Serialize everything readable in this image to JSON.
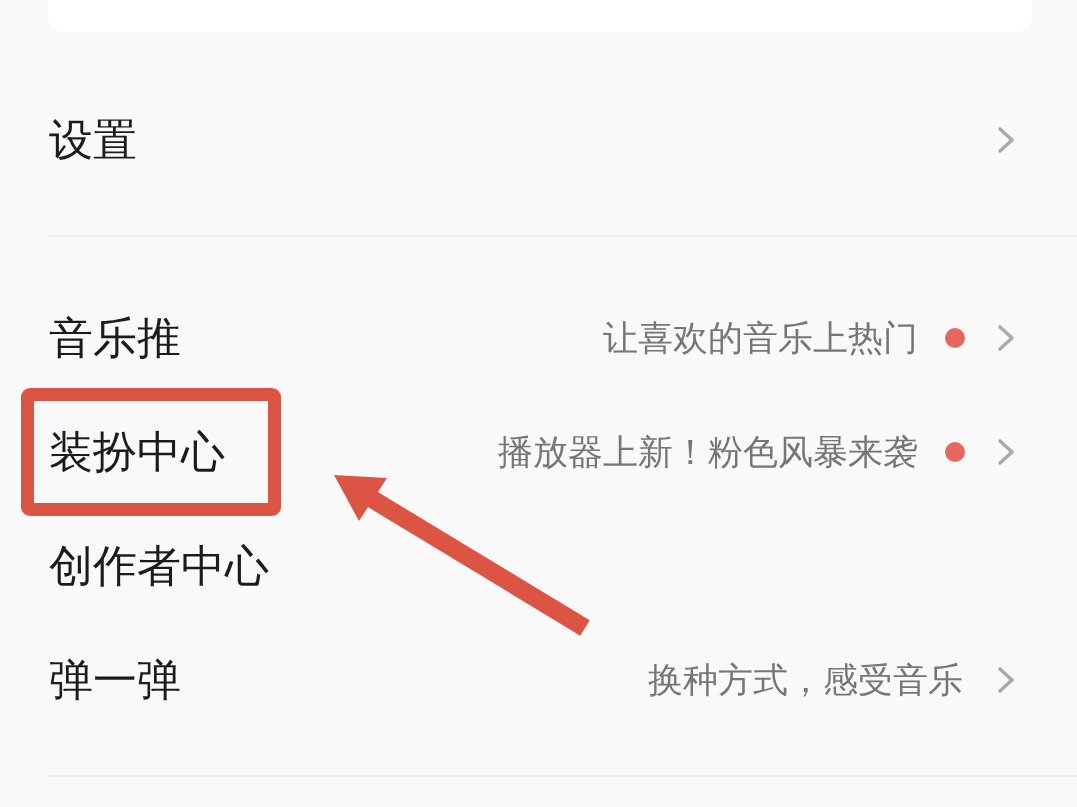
{
  "menu_groups": [
    {
      "items": [
        {
          "label": "设置",
          "dot": false,
          "chevron": true,
          "highlighted": false
        }
      ]
    },
    {
      "items": [
        {
          "label": "音乐推",
          "subtitle": "让喜欢的音乐上热门",
          "dot": true,
          "chevron": true,
          "highlighted": false
        },
        {
          "label": "装扮中心",
          "subtitle": "播放器上新！粉色风暴来袭",
          "dot": true,
          "chevron": true,
          "highlighted": true
        },
        {
          "label": "创作者中心",
          "dot": false,
          "chevron": false,
          "highlighted": false
        },
        {
          "label": "弹一弹",
          "subtitle": "换种方式，感受音乐",
          "dot": false,
          "chevron": true,
          "highlighted": false
        }
      ]
    }
  ]
}
